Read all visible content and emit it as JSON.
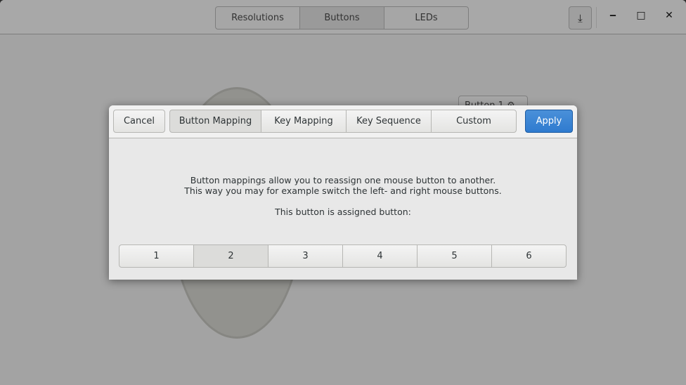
{
  "header": {
    "tabs": [
      {
        "label": "Resolutions"
      },
      {
        "label": "Buttons"
      },
      {
        "label": "LEDs"
      }
    ],
    "active_tab": "Buttons"
  },
  "background": {
    "button_label": "Button 1"
  },
  "dialog": {
    "cancel_label": "Cancel",
    "tabs": [
      {
        "label": "Button Mapping"
      },
      {
        "label": "Key Mapping"
      },
      {
        "label": "Key Sequence"
      },
      {
        "label": "Custom"
      }
    ],
    "active_tab": "Button Mapping",
    "apply_label": "Apply",
    "apply_color": "#3584e4",
    "description_line1": "Button mappings allow you to reassign one mouse button to another.",
    "description_line2": "This way you may for example switch the left- and right mouse buttons.",
    "assigned_label": "This button is assigned button:",
    "buttons": [
      {
        "label": "1"
      },
      {
        "label": "2"
      },
      {
        "label": "3"
      },
      {
        "label": "4"
      },
      {
        "label": "5"
      },
      {
        "label": "6"
      }
    ],
    "selected_button": "2"
  }
}
